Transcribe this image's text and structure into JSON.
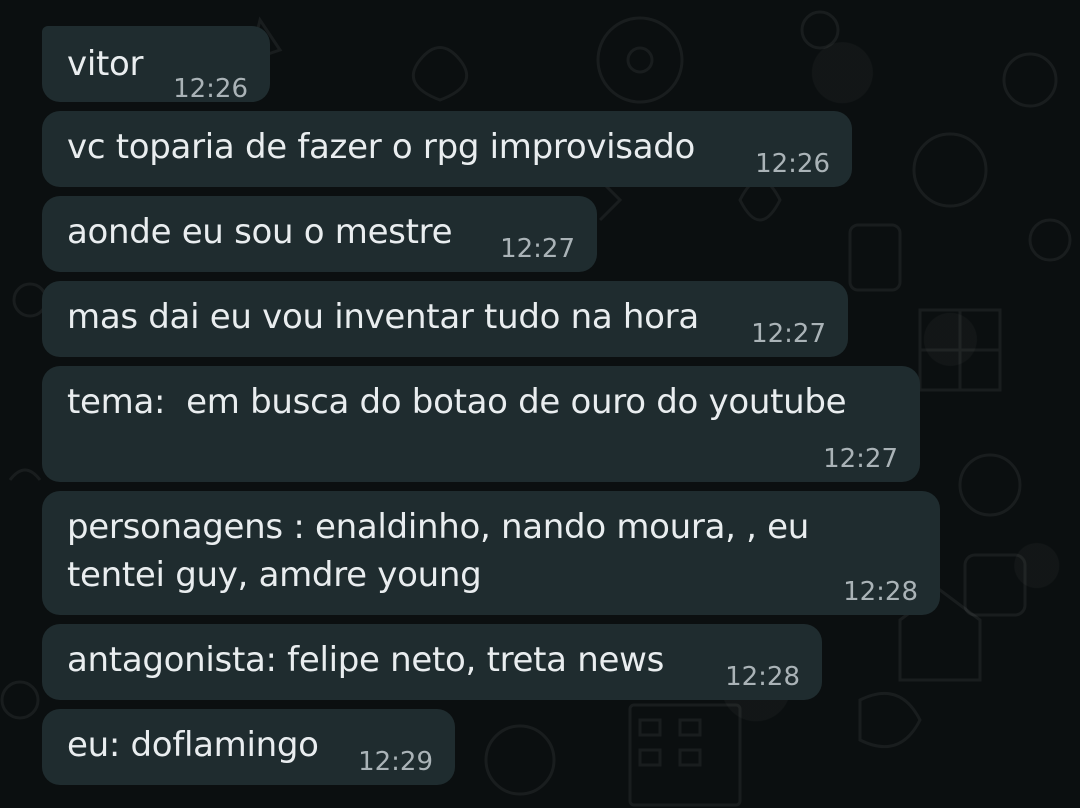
{
  "messages": [
    {
      "text": "vitor",
      "time": "12:26"
    },
    {
      "text": "vc toparia de fazer o rpg improvisado",
      "time": "12:26"
    },
    {
      "text": "aonde eu sou o mestre",
      "time": "12:27"
    },
    {
      "text": "mas dai eu vou inventar tudo na hora",
      "time": "12:27"
    },
    {
      "text": "tema:  em busca do botao de ouro do youtube",
      "time": "12:27"
    },
    {
      "text_line1": "personagens : enaldinho, nando moura, , eu",
      "text_line2": "tentei guy, amdre young",
      "time": "12:28"
    },
    {
      "text": "antagonista: felipe neto, treta news",
      "time": "12:28"
    },
    {
      "text": "eu: doflamingo",
      "time": "12:29"
    }
  ],
  "colors": {
    "background": "#0b0f10",
    "bubble": "#1f2c2f",
    "text": "#e9edef",
    "time": "#aab3b7"
  }
}
